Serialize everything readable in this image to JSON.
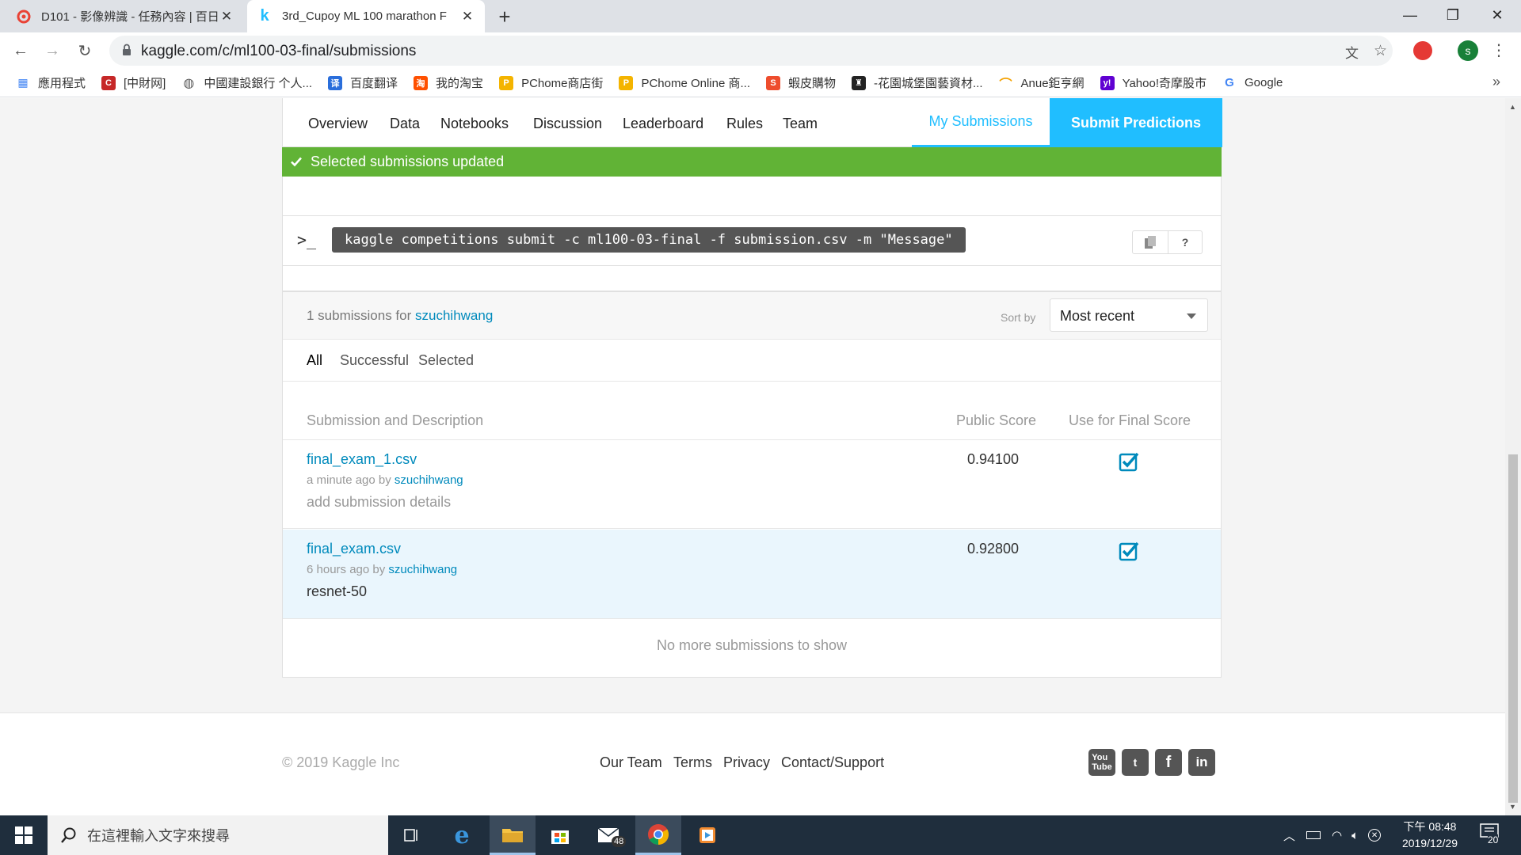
{
  "browser": {
    "tabs": [
      {
        "title": "D101 - 影像辨識 - 任務內容 | 百日",
        "favicon": "cupoy-icon",
        "color": "#e94235"
      },
      {
        "title": "3rd_Cupoy ML 100 marathon F",
        "favicon": "kaggle-icon",
        "color": "#20beff"
      }
    ],
    "url": "kaggle.com/c/ml100-03-final/submissions",
    "profile_initial": "s",
    "bookmarks": [
      {
        "label": "應用程式",
        "icon": "apps-grid-icon"
      },
      {
        "label": "[中財网]",
        "icon": "cfi-icon"
      },
      {
        "label": "中國建設銀行 个人...",
        "icon": "globe-icon"
      },
      {
        "label": "百度翻译",
        "icon": "baidu-translate-icon"
      },
      {
        "label": "我的淘宝",
        "icon": "taobao-icon"
      },
      {
        "label": "PChome商店街",
        "icon": "pchome-icon"
      },
      {
        "label": "PChome Online 商...",
        "icon": "pchome-icon"
      },
      {
        "label": "蝦皮購物",
        "icon": "shopee-icon"
      },
      {
        "label": "-花園城堡園藝資材...",
        "icon": "castle-icon"
      },
      {
        "label": "Anue鉅亨網",
        "icon": "anue-icon"
      },
      {
        "label": "Yahoo!奇摩股市",
        "icon": "yahoo-icon"
      },
      {
        "label": "Google",
        "icon": "google-icon"
      }
    ],
    "more_bookmarks": "»"
  },
  "compnav": {
    "items": [
      "Overview",
      "Data",
      "Notebooks",
      "Discussion",
      "Leaderboard",
      "Rules",
      "Team"
    ],
    "my_submissions": "My Submissions",
    "submit_predictions": "Submit Predictions"
  },
  "banner": {
    "message": "Selected submissions updated"
  },
  "cli": {
    "prompt": ">_",
    "command": "kaggle competitions submit -c ml100-03-final -f submission.csv -m \"Message\"",
    "help": "?"
  },
  "submissions": {
    "count_text": "1 submissions for",
    "user": "szuchihwang",
    "sort_label": "Sort by",
    "sort_value": "Most recent",
    "filters": [
      "All",
      "Successful",
      "Selected"
    ],
    "active_filter": "All",
    "columns": {
      "description": "Submission and Description",
      "public": "Public Score",
      "final": "Use for Final Score"
    },
    "rows": [
      {
        "file": "final_exam_1.csv",
        "time": "a minute ago by",
        "user": "szuchihwang",
        "desc": "add submission details",
        "score": "0.94100",
        "selected": true
      },
      {
        "file": "final_exam.csv",
        "time": "6 hours ago by",
        "user": "szuchihwang",
        "desc": "resnet-50",
        "score": "0.92800",
        "selected": true
      }
    ],
    "no_more": "No more submissions to show"
  },
  "footer": {
    "copyright": "© 2019 Kaggle Inc",
    "links": [
      "Our Team",
      "Terms",
      "Privacy",
      "Contact/Support"
    ],
    "social": [
      "youtube-icon",
      "twitter-icon",
      "facebook-icon",
      "linkedin-icon"
    ]
  },
  "taskbar": {
    "search_placeholder": "在這裡輸入文字來搜尋",
    "mail_badge": "48",
    "time": "下午 08:48",
    "date": "2019/12/29",
    "notification_count": "20"
  },
  "colors": {
    "kaggle_blue": "#20beff",
    "link_blue": "#008abc",
    "success_green": "#61b336"
  }
}
